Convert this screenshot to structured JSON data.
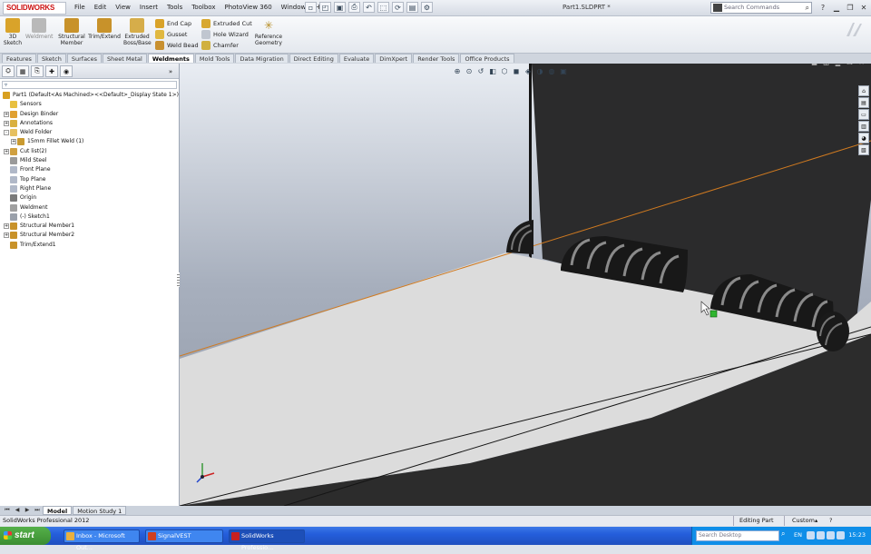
{
  "app": {
    "logo": "SOLIDWORKS",
    "doc_title": "Part1.SLDPRT *",
    "menus": [
      "File",
      "Edit",
      "View",
      "Insert",
      "Tools",
      "Toolbox",
      "PhotoView 360",
      "Window",
      "Help"
    ],
    "search_placeholder": "Search Commands",
    "help_label": "?"
  },
  "ribbon": {
    "big": [
      {
        "label": "3D Sketch",
        "color": "#d9a32a"
      },
      {
        "label": "Weldment",
        "color": "#b9b9b9"
      },
      {
        "label": "Structural Member",
        "color": "#c8922a"
      },
      {
        "label": "Trim/Extend",
        "color": "#c8922a"
      },
      {
        "label": "Extruded Boss/Base",
        "color": "#d6ad4a"
      }
    ],
    "small_col1": [
      "End Cap",
      "Gusset",
      "Weld Bead"
    ],
    "small_col2": [
      "Extruded Cut",
      "Hole Wizard",
      "Chamfer"
    ],
    "ref_geometry": "Reference Geometry"
  },
  "command_tabs": [
    "Features",
    "Sketch",
    "Surfaces",
    "Sheet Metal",
    "Weldments",
    "Mold Tools",
    "Data Migration",
    "Direct Editing",
    "Evaluate",
    "DimXpert",
    "Render Tools",
    "Office Products"
  ],
  "active_tab": "Weldments",
  "feature_tree": [
    {
      "label": "Part1  (Default<As Machined><<Default>_Display State 1>)",
      "indent": 0,
      "exp": "",
      "color": "#d8a020"
    },
    {
      "label": "Sensors",
      "indent": 1,
      "exp": "",
      "color": "#e8c040"
    },
    {
      "label": "Design Binder",
      "indent": 1,
      "exp": "+",
      "color": "#e0a030"
    },
    {
      "label": "Annotations",
      "indent": 1,
      "exp": "+",
      "color": "#d9b040"
    },
    {
      "label": "Weld Folder",
      "indent": 1,
      "exp": "-",
      "color": "#e6c060"
    },
    {
      "label": "15mm Fillet Weld (1)",
      "indent": 2,
      "exp": "+",
      "color": "#c99a30"
    },
    {
      "label": "Cut list(2)",
      "indent": 1,
      "exp": "+",
      "color": "#d0a040"
    },
    {
      "label": "Mild Steel",
      "indent": 1,
      "exp": "",
      "color": "#9a9a9a"
    },
    {
      "label": "Front Plane",
      "indent": 1,
      "exp": "",
      "color": "#b0b8c8"
    },
    {
      "label": "Top Plane",
      "indent": 1,
      "exp": "",
      "color": "#b0b8c8"
    },
    {
      "label": "Right Plane",
      "indent": 1,
      "exp": "",
      "color": "#b0b8c8"
    },
    {
      "label": "Origin",
      "indent": 1,
      "exp": "",
      "color": "#7a7a7a"
    },
    {
      "label": "Weldment",
      "indent": 1,
      "exp": "",
      "color": "#a0a0a0"
    },
    {
      "label": "(-) Sketch1",
      "indent": 1,
      "exp": "",
      "color": "#9aa0aa"
    },
    {
      "label": "Structural Member1",
      "indent": 1,
      "exp": "+",
      "color": "#c8922a"
    },
    {
      "label": "Structural Member2",
      "indent": 1,
      "exp": "+",
      "color": "#c8922a"
    },
    {
      "label": "Trim/Extend1",
      "indent": 1,
      "exp": "",
      "color": "#c8922a"
    }
  ],
  "model_tabs": [
    "Model",
    "Motion Study 1"
  ],
  "status": {
    "product": "SolidWorks Professional 2012",
    "mode": "Editing Part",
    "units": "Custom"
  },
  "taskbar": {
    "start": "start",
    "items": [
      {
        "label": "Inbox - Microsoft Out...",
        "color": "#e8b040"
      },
      {
        "label": "SignalVEST",
        "color": "#d04020"
      },
      {
        "label": "SolidWorks Professio...",
        "color": "#c82020"
      }
    ],
    "desktop_search": "Search Desktop",
    "lang": "EN",
    "clock": "15:23"
  }
}
